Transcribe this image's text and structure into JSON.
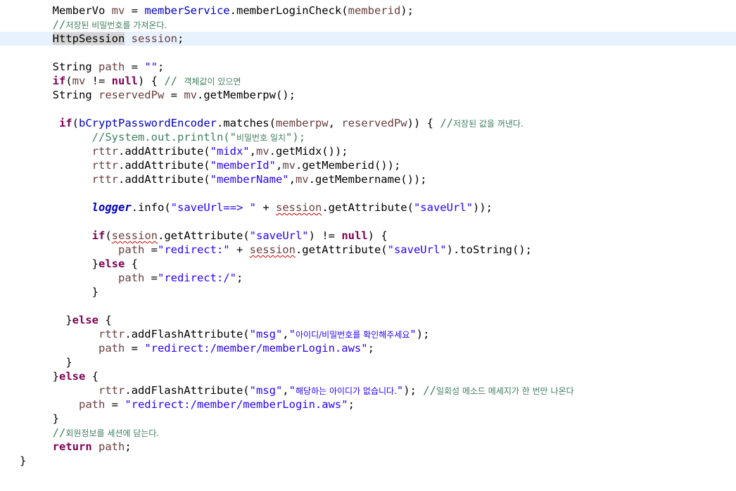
{
  "editor": {
    "lines": [
      {
        "indent": "        ",
        "tokens": [
          {
            "t": "MemberVo "
          },
          {
            "t": "mv",
            "c": "var"
          },
          {
            "t": " = "
          },
          {
            "t": "memberService",
            "c": "fld"
          },
          {
            "t": ".memberLoginCheck("
          },
          {
            "t": "memberid",
            "c": "var"
          },
          {
            "t": ");"
          }
        ]
      },
      {
        "indent": "        ",
        "tokens": [
          {
            "t": "//",
            "c": "cmt"
          },
          {
            "t": "저장된 비밀번호를 가져온다.",
            "c": "cmt ko"
          }
        ]
      },
      {
        "indent": "        ",
        "current": true,
        "tokens": [
          {
            "t": "HttpSession",
            "c": "sel"
          },
          {
            "t": " "
          },
          {
            "t": "session",
            "c": "var"
          },
          {
            "t": ";"
          }
        ]
      },
      {
        "indent": "",
        "tokens": []
      },
      {
        "indent": "        ",
        "tokens": [
          {
            "t": "String "
          },
          {
            "t": "path",
            "c": "var"
          },
          {
            "t": " = "
          },
          {
            "t": "\"\"",
            "c": "str"
          },
          {
            "t": ";"
          }
        ]
      },
      {
        "indent": "        ",
        "tokens": [
          {
            "t": "if",
            "c": "kw"
          },
          {
            "t": "("
          },
          {
            "t": "mv",
            "c": "var"
          },
          {
            "t": " != "
          },
          {
            "t": "null",
            "c": "kw"
          },
          {
            "t": ") { "
          },
          {
            "t": "// ",
            "c": "cmt"
          },
          {
            "t": "객체값이 있으면",
            "c": "cmt ko"
          }
        ]
      },
      {
        "indent": "        ",
        "tokens": [
          {
            "t": "String "
          },
          {
            "t": "reservedPw",
            "c": "var"
          },
          {
            "t": " = "
          },
          {
            "t": "mv",
            "c": "var"
          },
          {
            "t": ".getMemberpw();"
          }
        ]
      },
      {
        "indent": "",
        "tokens": []
      },
      {
        "indent": "         ",
        "tokens": [
          {
            "t": "if",
            "c": "kw"
          },
          {
            "t": "("
          },
          {
            "t": "bCryptPasswordEncoder",
            "c": "fld"
          },
          {
            "t": ".matches("
          },
          {
            "t": "memberpw",
            "c": "var"
          },
          {
            "t": ", "
          },
          {
            "t": "reservedPw",
            "c": "var"
          },
          {
            "t": ")) { "
          },
          {
            "t": "//",
            "c": "cmt"
          },
          {
            "t": "저장된 값을 꺼낸다.",
            "c": "cmt ko"
          }
        ]
      },
      {
        "indent": "              ",
        "tokens": [
          {
            "t": "//System.out.println(\"",
            "c": "cmt"
          },
          {
            "t": "비밀번호 일치",
            "c": "cmt ko"
          },
          {
            "t": "\");",
            "c": "cmt"
          }
        ]
      },
      {
        "indent": "              ",
        "tokens": [
          {
            "t": "rttr",
            "c": "var"
          },
          {
            "t": ".addAttribute("
          },
          {
            "t": "\"midx\"",
            "c": "str"
          },
          {
            "t": ","
          },
          {
            "t": "mv",
            "c": "var"
          },
          {
            "t": ".getMidx());"
          }
        ]
      },
      {
        "indent": "              ",
        "tokens": [
          {
            "t": "rttr",
            "c": "var"
          },
          {
            "t": ".addAttribute("
          },
          {
            "t": "\"memberId\"",
            "c": "str"
          },
          {
            "t": ","
          },
          {
            "t": "mv",
            "c": "var"
          },
          {
            "t": ".getMemberid());"
          }
        ]
      },
      {
        "indent": "              ",
        "tokens": [
          {
            "t": "rttr",
            "c": "var"
          },
          {
            "t": ".addAttribute("
          },
          {
            "t": "\"memberName\"",
            "c": "str"
          },
          {
            "t": ","
          },
          {
            "t": "mv",
            "c": "var"
          },
          {
            "t": ".getMembername());"
          }
        ]
      },
      {
        "indent": "",
        "tokens": []
      },
      {
        "indent": "              ",
        "tokens": [
          {
            "t": "logger",
            "c": "stat"
          },
          {
            "t": ".info("
          },
          {
            "t": "\"saveUrl==> \"",
            "c": "str"
          },
          {
            "t": " + "
          },
          {
            "t": "session",
            "c": "var warn"
          },
          {
            "t": ".getAttribute("
          },
          {
            "t": "\"saveUrl\"",
            "c": "str"
          },
          {
            "t": "));"
          }
        ]
      },
      {
        "indent": "",
        "tokens": []
      },
      {
        "indent": "              ",
        "tokens": [
          {
            "t": "if",
            "c": "kw"
          },
          {
            "t": "("
          },
          {
            "t": "session",
            "c": "var warn"
          },
          {
            "t": ".getAttribute("
          },
          {
            "t": "\"saveUrl\"",
            "c": "str"
          },
          {
            "t": ") != "
          },
          {
            "t": "null",
            "c": "kw"
          },
          {
            "t": ") {"
          }
        ]
      },
      {
        "indent": "                  ",
        "tokens": [
          {
            "t": "path",
            "c": "var"
          },
          {
            "t": " ="
          },
          {
            "t": "\"redirect:\"",
            "c": "str"
          },
          {
            "t": " + "
          },
          {
            "t": "session",
            "c": "var warn"
          },
          {
            "t": ".getAttribute("
          },
          {
            "t": "\"saveUrl\"",
            "c": "str"
          },
          {
            "t": ").toString();"
          }
        ]
      },
      {
        "indent": "              ",
        "tokens": [
          {
            "t": "}"
          },
          {
            "t": "else",
            "c": "kw"
          },
          {
            "t": " {"
          }
        ]
      },
      {
        "indent": "                  ",
        "tokens": [
          {
            "t": "path",
            "c": "var"
          },
          {
            "t": " ="
          },
          {
            "t": "\"redirect:/\"",
            "c": "str"
          },
          {
            "t": ";"
          }
        ]
      },
      {
        "indent": "              ",
        "tokens": [
          {
            "t": "}"
          }
        ]
      },
      {
        "indent": "",
        "tokens": []
      },
      {
        "indent": "          ",
        "tokens": [
          {
            "t": "}"
          },
          {
            "t": "else",
            "c": "kw"
          },
          {
            "t": " {"
          }
        ]
      },
      {
        "indent": "               ",
        "tokens": [
          {
            "t": "rttr",
            "c": "var"
          },
          {
            "t": ".addFlashAttribute("
          },
          {
            "t": "\"msg\"",
            "c": "str"
          },
          {
            "t": ","
          },
          {
            "t": "\"",
            "c": "str"
          },
          {
            "t": "아이디/비밀번호를 확인해주세요",
            "c": "str ko"
          },
          {
            "t": "\"",
            "c": "str"
          },
          {
            "t": ");"
          }
        ]
      },
      {
        "indent": "               ",
        "tokens": [
          {
            "t": "path",
            "c": "var"
          },
          {
            "t": " = "
          },
          {
            "t": "\"redirect:/member/memberLogin.aws\"",
            "c": "str"
          },
          {
            "t": ";"
          }
        ]
      },
      {
        "indent": "          ",
        "tokens": [
          {
            "t": "}"
          }
        ]
      },
      {
        "indent": "        ",
        "tokens": [
          {
            "t": "}"
          },
          {
            "t": "else",
            "c": "kw"
          },
          {
            "t": " {"
          }
        ]
      },
      {
        "indent": "               ",
        "tokens": [
          {
            "t": "rttr",
            "c": "var"
          },
          {
            "t": ".addFlashAttribute("
          },
          {
            "t": "\"msg\"",
            "c": "str"
          },
          {
            "t": ","
          },
          {
            "t": "\"",
            "c": "str"
          },
          {
            "t": "해당하는 아이디가 없습니다.",
            "c": "str ko"
          },
          {
            "t": "\"",
            "c": "str"
          },
          {
            "t": "); "
          },
          {
            "t": "//",
            "c": "cmt"
          },
          {
            "t": "일회성 메소드 메세지가 한 번만 나온다",
            "c": "cmt ko"
          }
        ]
      },
      {
        "indent": "            ",
        "tokens": [
          {
            "t": "path",
            "c": "var"
          },
          {
            "t": " = "
          },
          {
            "t": "\"redirect:/member/memberLogin.aws\"",
            "c": "str"
          },
          {
            "t": ";"
          }
        ]
      },
      {
        "indent": "        ",
        "tokens": [
          {
            "t": "}"
          }
        ]
      },
      {
        "indent": "        ",
        "tokens": [
          {
            "t": "//",
            "c": "cmt"
          },
          {
            "t": "회원정보를 세션에 담는다.",
            "c": "cmt ko"
          }
        ]
      },
      {
        "indent": "        ",
        "tokens": [
          {
            "t": "return",
            "c": "kw"
          },
          {
            "t": " "
          },
          {
            "t": "path",
            "c": "var"
          },
          {
            "t": ";"
          }
        ]
      },
      {
        "indent": "   ",
        "tokens": [
          {
            "t": "}"
          }
        ]
      }
    ]
  }
}
